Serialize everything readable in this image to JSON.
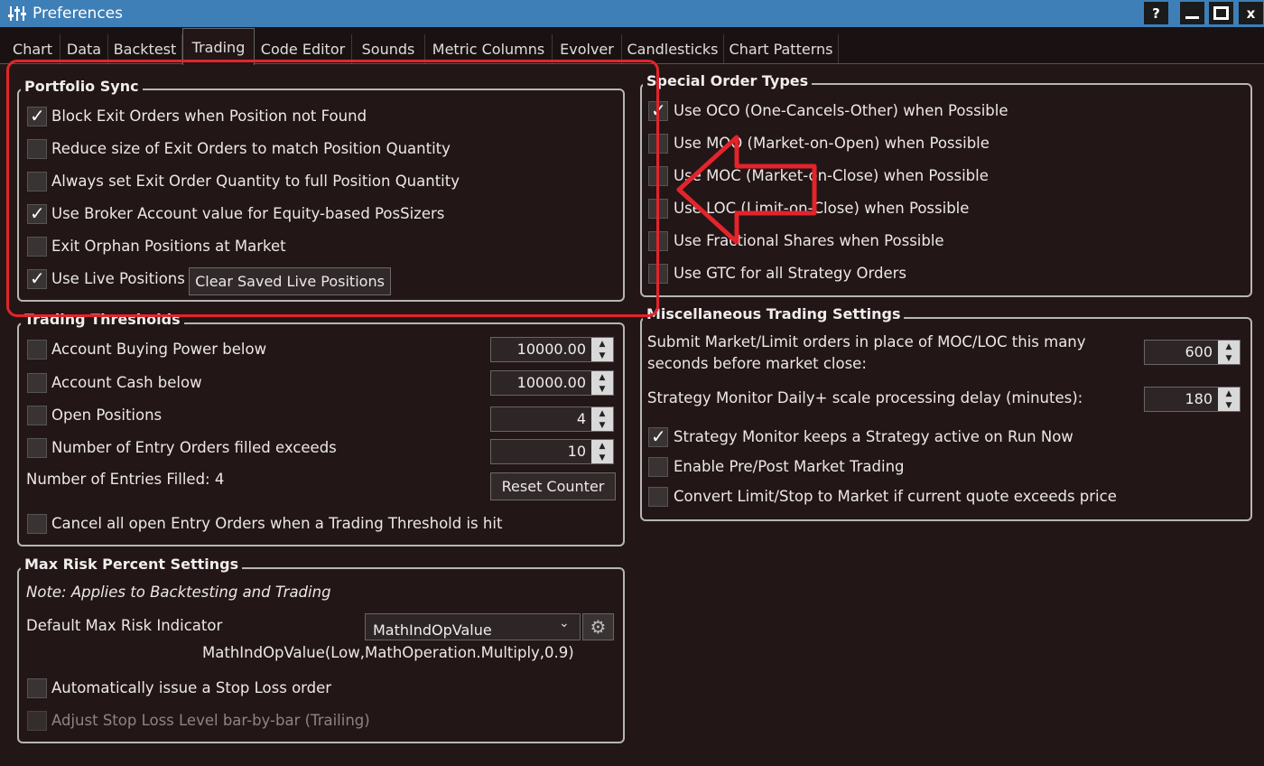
{
  "window": {
    "title": "Preferences",
    "help": "?",
    "minimize": "—",
    "maximize": "□",
    "close": "x"
  },
  "tabs": [
    "Chart",
    "Data",
    "Backtest",
    "Trading",
    "Code Editor",
    "Sounds",
    "Metric Columns",
    "Evolver",
    "Candlesticks",
    "Chart Patterns"
  ],
  "active_tab": "Trading",
  "portfolio_sync": {
    "title": "Portfolio Sync",
    "items": [
      {
        "label": "Block Exit Orders when Position not Found",
        "checked": true
      },
      {
        "label": "Reduce size of Exit Orders to match Position Quantity",
        "checked": false
      },
      {
        "label": "Always set Exit Order Quantity to full Position Quantity",
        "checked": false
      },
      {
        "label": "Use Broker Account value for Equity-based PosSizers",
        "checked": true
      },
      {
        "label": "Exit Orphan Positions at Market",
        "checked": false
      },
      {
        "label": "Use Live Positions",
        "checked": true
      }
    ],
    "clear_button": "Clear Saved Live Positions"
  },
  "trading_thresholds": {
    "title": "Trading Thresholds",
    "items": [
      {
        "label": "Account Buying Power below",
        "value": "10000.00"
      },
      {
        "label": "Account Cash below",
        "value": "10000.00"
      },
      {
        "label": "Open Positions",
        "value": "4"
      },
      {
        "label": "Number of Entry Orders filled exceeds",
        "value": "10"
      }
    ],
    "entries_filled": "Number of Entries Filled: 4",
    "reset_button": "Reset Counter",
    "cancel_label": "Cancel all open Entry Orders when a Trading Threshold is hit"
  },
  "max_risk": {
    "title": "Max Risk Percent Settings",
    "note": "Note: Applies to Backtesting and Trading",
    "indicator_label": "Default Max Risk Indicator",
    "indicator_value": "MathIndOpValue",
    "indicator_expr": "MathIndOpValue(Low,MathOperation.Multiply,0.9)",
    "stop_loss_label": "Automatically issue a Stop Loss order",
    "trailing_label": "Adjust Stop Loss Level bar-by-bar (Trailing)"
  },
  "special_orders": {
    "title": "Special Order Types",
    "items": [
      {
        "label": "Use OCO (One-Cancels-Other) when Possible",
        "checked": true
      },
      {
        "label": "Use MOO (Market-on-Open) when Possible",
        "checked": false
      },
      {
        "label": "Use MOC (Market-on-Close) when Possible",
        "checked": false
      },
      {
        "label": "Use LOC (Limit-on-Close) when Possible",
        "checked": false
      },
      {
        "label": "Use Fractional Shares when Possible",
        "checked": false
      },
      {
        "label": "Use GTC for all Strategy Orders",
        "checked": false
      }
    ]
  },
  "misc": {
    "title": "Miscellaneous Trading Settings",
    "submit_line1": "Submit Market/Limit orders in place of MOC/LOC this many",
    "submit_line2": "seconds before market close:",
    "submit_value": "600",
    "delay_label": "Strategy Monitor Daily+ scale processing delay (minutes):",
    "delay_value": "180",
    "items": [
      {
        "label": "Strategy Monitor keeps a Strategy active on Run Now",
        "checked": true
      },
      {
        "label": "Enable Pre/Post Market Trading",
        "checked": false
      },
      {
        "label": "Convert Limit/Stop to Market if current quote exceeds price",
        "checked": false
      }
    ]
  },
  "colors": {
    "titlebar": "#3e7fb8",
    "background": "#231617",
    "highlight": "#e3242b"
  }
}
